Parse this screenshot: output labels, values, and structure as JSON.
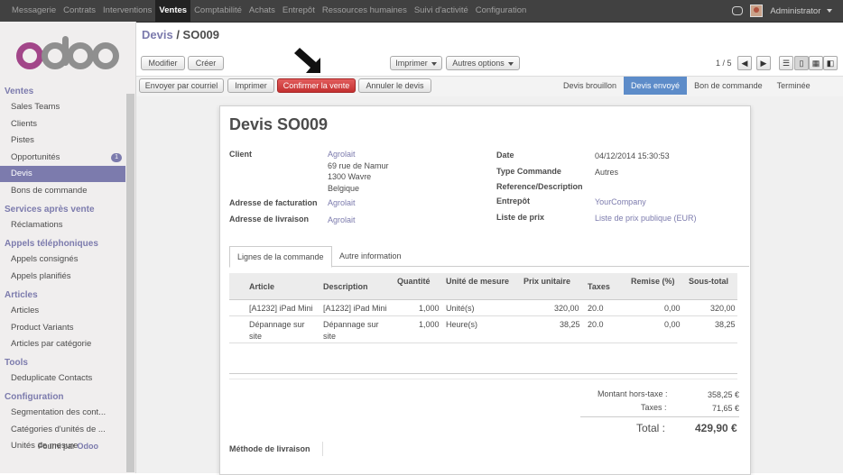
{
  "topbar": {
    "menu": [
      "Messagerie",
      "Contrats",
      "Interventions",
      "Ventes",
      "Comptabilité",
      "Achats",
      "Entrepôt",
      "Ressources humaines",
      "Suivi d'activité",
      "Configuration"
    ],
    "active_index": 3,
    "user": "Administrator"
  },
  "sidebar": {
    "sections": [
      {
        "title": "Ventes",
        "items": [
          {
            "label": "Sales Teams"
          },
          {
            "label": "Clients"
          },
          {
            "label": "Pistes"
          },
          {
            "label": "Opportunités",
            "badge": "1"
          },
          {
            "label": "Devis",
            "active": true
          },
          {
            "label": "Bons de commande"
          }
        ]
      },
      {
        "title": "Services après vente",
        "items": [
          {
            "label": "Réclamations"
          }
        ]
      },
      {
        "title": "Appels téléphoniques",
        "items": [
          {
            "label": "Appels consignés"
          },
          {
            "label": "Appels planifiés"
          }
        ]
      },
      {
        "title": "Articles",
        "items": [
          {
            "label": "Articles"
          },
          {
            "label": "Product Variants"
          },
          {
            "label": "Articles par catégorie"
          }
        ]
      },
      {
        "title": "Tools",
        "items": [
          {
            "label": "Deduplicate Contacts"
          }
        ]
      },
      {
        "title": "Configuration",
        "items": [
          {
            "label": "Segmentation des cont..."
          },
          {
            "label": "Catégories d'unités de ..."
          },
          {
            "label": "Unités de mesure"
          }
        ]
      }
    ],
    "footer_prefix": "Fourni par",
    "footer_brand": "Odoo"
  },
  "breadcrumb": {
    "parent": "Devis",
    "sep": " / ",
    "current": "SO009"
  },
  "toolbar": {
    "edit": "Modifier",
    "create": "Créer",
    "print": "Imprimer",
    "more": "Autres options",
    "pager": "1 / 5"
  },
  "actions": {
    "send_email": "Envoyer par courriel",
    "print": "Imprimer",
    "confirm": "Confirmer la vente",
    "cancel": "Annuler le devis"
  },
  "stages": [
    "Devis brouillon",
    "Devis envoyé",
    "Bon de commande",
    "Terminée"
  ],
  "stage_current": 1,
  "form": {
    "title": "Devis SO009",
    "client_label": "Client",
    "client_name": "Agrolait",
    "client_addr1": "69 rue de Namur",
    "client_addr2": "1300 Wavre",
    "client_addr3": "Belgique",
    "invoice_label": "Adresse de facturation",
    "invoice_value": "Agrolait",
    "delivery_label": "Adresse de livraison",
    "delivery_value": "Agrolait",
    "date_label": "Date",
    "date_value": "04/12/2014 15:30:53",
    "type_label": "Type Commande",
    "type_value": "Autres",
    "ref_label": "Reference/Description",
    "warehouse_label": "Entrepôt",
    "warehouse_value": "YourCompany",
    "pricelist_label": "Liste de prix",
    "pricelist_value": "Liste de prix publique (EUR)",
    "tab1": "Lignes de la commande",
    "tab2": "Autre information",
    "columns": {
      "article": "Article",
      "description": "Description",
      "qty": "Quantité",
      "uom": "Unité de mesure",
      "price": "Prix unitaire",
      "taxes": "Taxes",
      "discount": "Remise (%)",
      "subtotal": "Sous-total"
    },
    "lines": [
      {
        "article": "[A1232] iPad Mini",
        "article2": "",
        "description": "[A1232] iPad Mini",
        "description2": "",
        "qty": "1,000",
        "uom": "Unité(s)",
        "price": "320,00",
        "taxes": "20.0",
        "discount": "0,00",
        "subtotal": "320,00"
      },
      {
        "article": "Dépannage sur",
        "article2": "site",
        "description": "Dépannage sur",
        "description2": "site",
        "qty": "1,000",
        "uom": "Heure(s)",
        "price": "38,25",
        "taxes": "20.0",
        "discount": "0,00",
        "subtotal": "38,25"
      }
    ],
    "untaxed_label": "Montant hors-taxe :",
    "untaxed_value": "358,25 €",
    "taxes_label": "Taxes :",
    "taxes_value": "71,65 €",
    "total_label": "Total :",
    "total_value": "429,90 €",
    "shipping_label": "Méthode de livraison"
  },
  "colors": {
    "accent": "#7c7bad",
    "confirm": "#c43030",
    "stage_current": "#5d8cc9"
  }
}
